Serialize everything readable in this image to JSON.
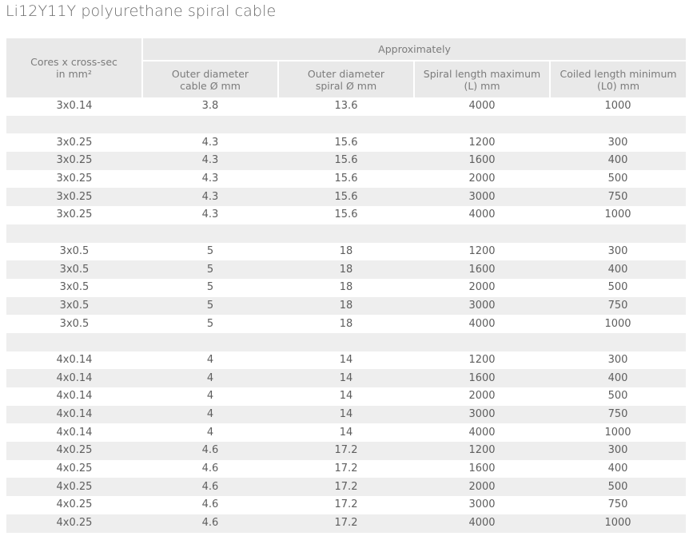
{
  "title": "Li12Y11Y polyurethane spiral cable",
  "header": {
    "cores": "Cores x cross-sec\nin mm²",
    "group": "Approximately",
    "outer_cable": "Outer diameter\ncable Ø mm",
    "outer_spiral": "Outer diameter\nspiral Ø mm",
    "spiral_len": "Spiral length maximum\n(L) mm",
    "coiled_len": "Coiled length minimum\n(L0) mm"
  },
  "rows": [
    [
      "3x0.14",
      "3.8",
      "13.6",
      "4000",
      "1000"
    ],
    [
      "",
      "",
      "",
      "",
      ""
    ],
    [
      "3x0.25",
      "4.3",
      "15.6",
      "1200",
      "300"
    ],
    [
      "3x0.25",
      "4.3",
      "15.6",
      "1600",
      "400"
    ],
    [
      "3x0.25",
      "4.3",
      "15.6",
      "2000",
      "500"
    ],
    [
      "3x0.25",
      "4.3",
      "15.6",
      "3000",
      "750"
    ],
    [
      "3x0.25",
      "4.3",
      "15.6",
      "4000",
      "1000"
    ],
    [
      "",
      "",
      "",
      "",
      ""
    ],
    [
      "3x0.5",
      "5",
      "18",
      "1200",
      "300"
    ],
    [
      "3x0.5",
      "5",
      "18",
      "1600",
      "400"
    ],
    [
      "3x0.5",
      "5",
      "18",
      "2000",
      "500"
    ],
    [
      "3x0.5",
      "5",
      "18",
      "3000",
      "750"
    ],
    [
      "3x0.5",
      "5",
      "18",
      "4000",
      "1000"
    ],
    [
      "",
      "",
      "",
      "",
      ""
    ],
    [
      "4x0.14",
      "4",
      "14",
      "1200",
      "300"
    ],
    [
      "4x0.14",
      "4",
      "14",
      "1600",
      "400"
    ],
    [
      "4x0.14",
      "4",
      "14",
      "2000",
      "500"
    ],
    [
      "4x0.14",
      "4",
      "14",
      "3000",
      "750"
    ],
    [
      "4x0.14",
      "4",
      "14",
      "4000",
      "1000"
    ],
    [
      "4x0.25",
      "4.6",
      "17.2",
      "1200",
      "300"
    ],
    [
      "4x0.25",
      "4.6",
      "17.2",
      "1600",
      "400"
    ],
    [
      "4x0.25",
      "4.6",
      "17.2",
      "2000",
      "500"
    ],
    [
      "4x0.25",
      "4.6",
      "17.2",
      "3000",
      "750"
    ],
    [
      "4x0.25",
      "4.6",
      "17.2",
      "4000",
      "1000"
    ]
  ]
}
